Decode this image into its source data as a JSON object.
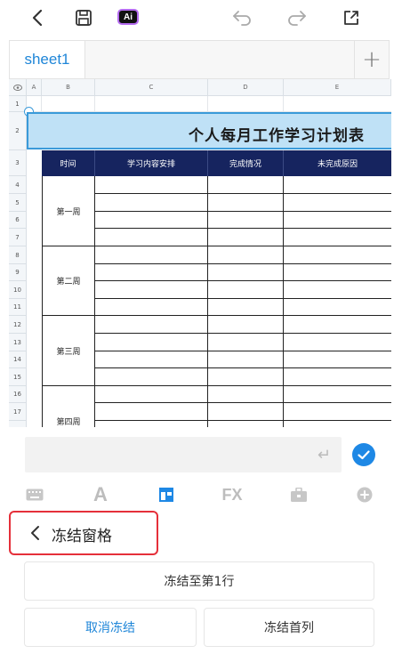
{
  "toolbar": {
    "ai_label": "Ai",
    "icons": [
      "back-icon",
      "save-icon",
      "ai-icon",
      "undo-icon",
      "redo-icon",
      "share-icon"
    ]
  },
  "tabs": {
    "active": "sheet1",
    "add_label": "+"
  },
  "sheet": {
    "column_headers": [
      "A",
      "B",
      "C",
      "D",
      "E"
    ],
    "row_headers": [
      "1",
      "2",
      "3",
      "4",
      "5",
      "6",
      "7",
      "8",
      "9",
      "10",
      "11",
      "12",
      "13",
      "14",
      "15",
      "16",
      "17"
    ],
    "title": "个人每月工作学习计划表",
    "table_headers": [
      "时间",
      "学习内容安排",
      "完成情况",
      "未完成原因"
    ],
    "weeks": [
      "第一周",
      "第二周",
      "第三周",
      "第四周"
    ]
  },
  "formula_bar": {
    "value": "",
    "enter_icon": "↵"
  },
  "format_toolbar": {
    "icons": [
      "keyboard-icon",
      "text-format-icon",
      "cell-layout-icon",
      "formula-icon",
      "toolbox-icon",
      "insert-icon"
    ],
    "fx_label": "FX",
    "a_label": "A"
  },
  "freeze_panel": {
    "title": "冻结窗格",
    "freeze_row": "冻结至第1行",
    "unfreeze": "取消冻结",
    "freeze_first_col": "冻结首列"
  },
  "colors": {
    "accent": "#1f86d8",
    "header_band": "#16245f",
    "title_band": "#bfe1f6",
    "highlight": "#e5303a"
  }
}
